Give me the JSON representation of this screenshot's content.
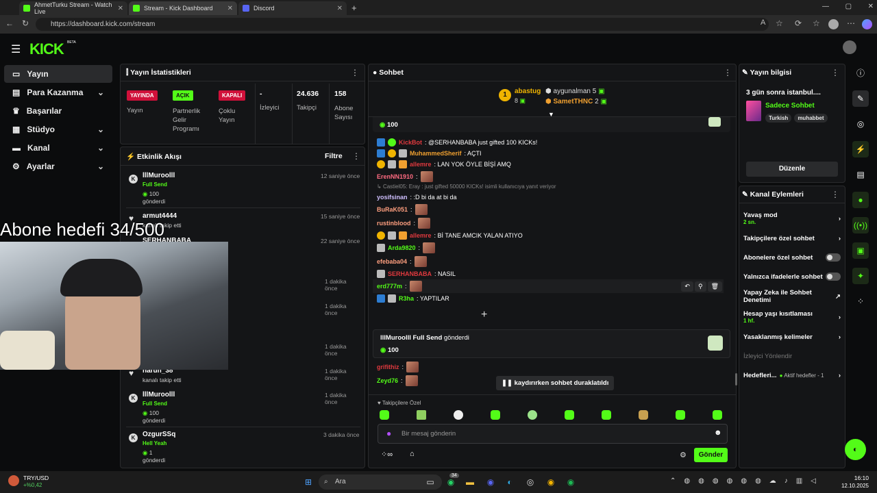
{
  "browser": {
    "tabs": [
      {
        "label": "AhmetTurku Stream - Watch Live"
      },
      {
        "label": "Stream - Kick Dashboard"
      },
      {
        "label": "Discord"
      }
    ],
    "url": "https://dashboard.kick.com/stream"
  },
  "header": {
    "logo": "KICK",
    "beta": "BETA"
  },
  "sidebar": {
    "items": [
      {
        "label": "Yayın"
      },
      {
        "label": "Para Kazanma"
      },
      {
        "label": "Başarılar"
      },
      {
        "label": "Stüdyo"
      },
      {
        "label": "Kanal"
      },
      {
        "label": "Ayarlar"
      }
    ]
  },
  "stats": {
    "title": "Yayın İstatistikleri",
    "cols": [
      {
        "badge": "YAYINDA",
        "label": "Yayın"
      },
      {
        "badge": "AÇIK",
        "label": "Partnerlik Gelir Programı"
      },
      {
        "badge": "KAPALI",
        "label": "Çoklu Yayın"
      },
      {
        "value": "-",
        "label": "İzleyici"
      },
      {
        "value": "24.636",
        "label": "Takipçi"
      },
      {
        "value": "158",
        "label": "Abone Sayısı"
      }
    ]
  },
  "events": {
    "title": "Etkinlik Akışı",
    "filter": "Filtre",
    "items": [
      {
        "name": "lllMuroolll",
        "sub": "Full Send",
        "amount": "100",
        "note": "gönderdi",
        "time": "12 saniye önce"
      },
      {
        "name": "armut4444",
        "note": "kanalı takip etti",
        "time": "15 saniye önce"
      },
      {
        "name": "SERHANBABA",
        "time": "22 saniye önce"
      },
      {
        "time": "1 dakika önce"
      },
      {
        "time": "1 dakika önce"
      },
      {
        "time": "1 dakika önce"
      },
      {
        "name": "harun_38",
        "note": "kanalı takip etti",
        "time": "1 dakika önce"
      },
      {
        "name": "lllMuroolll",
        "sub": "Full Send",
        "amount": "100",
        "note": "gönderdi",
        "time": "1 dakika önce"
      },
      {
        "name": "OzgurSSq",
        "sub": "Hell Yeah",
        "amount": "1",
        "note": "gönderdi",
        "time": "3 dakika önce"
      }
    ]
  },
  "overlay": {
    "goal": "Abone hedefi 34/500"
  },
  "chat": {
    "title": "Sohbet",
    "top": [
      {
        "name": "abastug",
        "count": "8"
      },
      {
        "name": "aygunalman",
        "count": "5"
      },
      {
        "name": "SametTHNC",
        "count": "2"
      }
    ],
    "pinned_amount": "100",
    "messages": [
      {
        "user": "KickBot",
        "color": "#e0393e",
        "text": ": @SERHANBABA just gifted 100 KICKs!"
      },
      {
        "user": "MuhammedSherif",
        "color": "#f0a030",
        "text": ": AÇTI"
      },
      {
        "user": "allemre",
        "color": "#e0393e",
        "text": ": LAN YOK ÖYLE BİŞİ AMQ"
      },
      {
        "user": "ErenNN1910",
        "color": "#ff6b81",
        "text": ":"
      },
      {
        "user": "yosifsinan",
        "color": "#d0c0ff",
        "text": ": :D bi da at bi da",
        "reply": "Castiel05:  Eray : just gifted 50000 KICKs! isimli kullanıcıya yanıt veriyor"
      },
      {
        "user": "BuRaK051",
        "color": "#ff9f7f",
        "text": ":"
      },
      {
        "user": "rustinblood",
        "color": "#ff9f7f",
        "text": ":"
      },
      {
        "user": "allemre",
        "color": "#e0393e",
        "text": ": Bİ TANE AMCIK YALAN ATIYO"
      },
      {
        "user": "Arda9820",
        "color": "#53fc18",
        "text": ":"
      },
      {
        "user": "efebaba04",
        "color": "#ff9f7f",
        "text": ":"
      },
      {
        "user": "SERHANBABA",
        "color": "#e0393e",
        "text": ": NASIL"
      },
      {
        "user": "erd777m",
        "color": "#53fc18",
        "text": ":"
      },
      {
        "user": "R3ha",
        "color": "#53fc18",
        "text": ": YAPTILAR"
      }
    ],
    "gift": {
      "user": "lllMuroolll",
      "item": "Full Send",
      "verb": "gönderdi",
      "amount": "100"
    },
    "after": [
      {
        "user": "grifithiz",
        "color": "#e0393e"
      },
      {
        "user": "Zeyd76",
        "color": "#53fc18"
      }
    ],
    "paused": "kaydırırken sohbet duraklatıldı",
    "followers_only": "Takipçilere Özel",
    "placeholder": "Bir mesaj gönderin",
    "send": "Gönder"
  },
  "info": {
    "title": "Yayın bilgisi",
    "stream_title": "3 gün sonra istanbul....",
    "category": "Sadece Sohbet",
    "tags": [
      "Turkish",
      "muhabbet"
    ],
    "edit": "Düzenle"
  },
  "actions": {
    "title": "Kanal Eylemleri",
    "items": [
      {
        "label": "Yavaş mod",
        "sub": "2 sn."
      },
      {
        "label": "Takipçilere özel sohbet"
      },
      {
        "label": "Abonelere özel sohbet"
      },
      {
        "label": "Yalnızca ifadelerle sohbet"
      },
      {
        "label": "Yapay Zeka ile Sohbet Denetimi"
      },
      {
        "label": "Hesap yaşı kısıtlaması",
        "sub": "1 hf."
      },
      {
        "label": "Yasaklanmış kelimeler"
      },
      {
        "label": "İzleyici Yönlendir"
      },
      {
        "label": "Hedefleri...",
        "sub": "Aktif hedefler - 1"
      }
    ]
  },
  "taskbar": {
    "stock": "TRY/USD",
    "change": "+%0,42",
    "search": "Ara",
    "badge": "34",
    "time": "16:10",
    "date": "12.10.2025"
  }
}
